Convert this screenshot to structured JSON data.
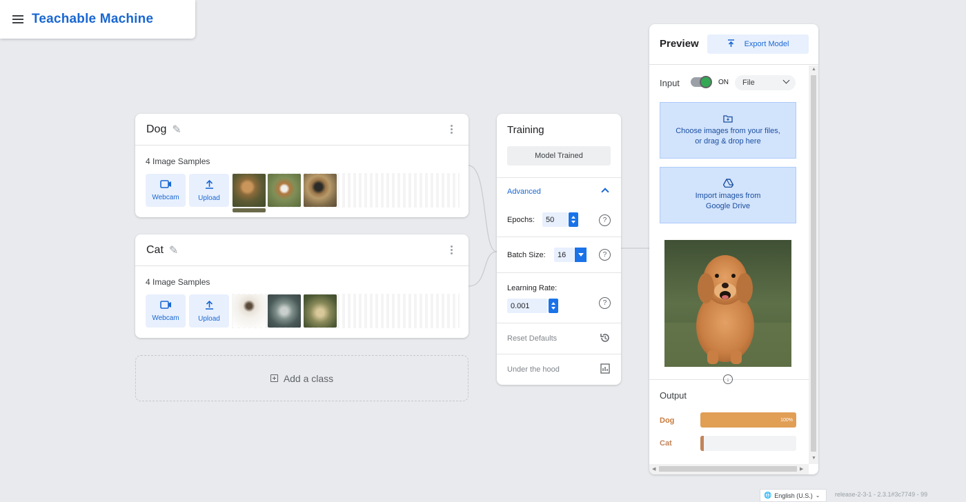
{
  "header": {
    "title": "Teachable Machine"
  },
  "classes": [
    {
      "name": "Dog",
      "samples_label": "4 Image Samples",
      "webcam_label": "Webcam",
      "upload_label": "Upload"
    },
    {
      "name": "Cat",
      "samples_label": "4 Image Samples",
      "webcam_label": "Webcam",
      "upload_label": "Upload"
    }
  ],
  "add_class_label": "Add a class",
  "training": {
    "title": "Training",
    "button_label": "Model Trained",
    "advanced_label": "Advanced",
    "epochs_label": "Epochs:",
    "epochs_value": "50",
    "batch_label": "Batch Size:",
    "batch_value": "16",
    "lr_label": "Learning Rate:",
    "lr_value": "0.001",
    "reset_label": "Reset Defaults",
    "hood_label": "Under the hood"
  },
  "preview": {
    "title": "Preview",
    "export_label": "Export Model",
    "input_label": "Input",
    "toggle_state": "ON",
    "input_source": "File",
    "choose_text": "Choose images from your files, or drag & drop here",
    "drive_text": "Import images from Google Drive",
    "output_title": "Output",
    "outputs": [
      {
        "label": "Dog",
        "percent_text": "100%",
        "value": 100,
        "color": "#e19e55"
      },
      {
        "label": "Cat",
        "percent_text": "",
        "value": 0,
        "color": "#c2845a"
      }
    ]
  },
  "footer": {
    "language": "English (U.S.)",
    "release": "release-2-3-1 - 2.3.1#3c7749 - 99"
  }
}
